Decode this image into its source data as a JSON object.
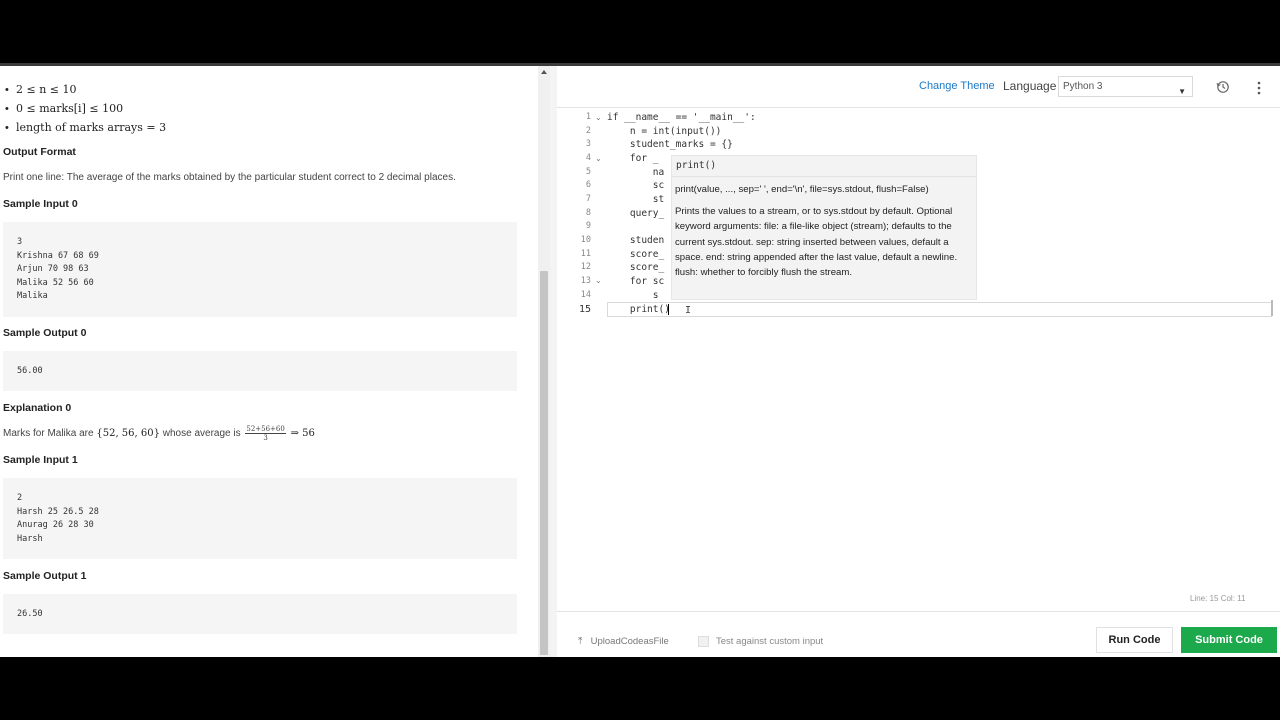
{
  "problem": {
    "constraints": [
      "2 ≤ n ≤ 10",
      "0 ≤ marks[i] ≤ 100",
      "length of marks arrays = 3"
    ],
    "output_format_title": "Output Format",
    "output_format_text": "Print one line: The average of the marks obtained by the particular student correct to 2 decimal places.",
    "sample_input_0_title": "Sample Input 0",
    "sample_input_0_lines": [
      "3",
      "Krishna 67 68 69",
      "Arjun 70 98 63",
      "Malika 52 56 60",
      "Malika"
    ],
    "sample_output_0_title": "Sample Output 0",
    "sample_output_0_value": "56.00",
    "explanation_0_title": "Explanation 0",
    "explanation_0_prefix": "Marks for Malika are",
    "explanation_0_set": "{52, 56, 60}",
    "explanation_0_middle": "whose average is",
    "explanation_0_numerator": "52+56+60",
    "explanation_0_denominator": "3",
    "explanation_0_result": "⇒ 56",
    "sample_input_1_title": "Sample Input 1",
    "sample_input_1_lines": [
      "2",
      "Harsh 25 26.5 28",
      "Anurag 26 28 30",
      "Harsh"
    ],
    "sample_output_1_title": "Sample Output 1",
    "sample_output_1_value": "26.50"
  },
  "editor": {
    "change_theme": "Change Theme",
    "language_label": "Language",
    "language_value": "Python 3",
    "line_numbers": [
      "1",
      "2",
      "3",
      "4",
      "5",
      "6",
      "7",
      "8",
      "9",
      "10",
      "11",
      "12",
      "13",
      "14",
      "15"
    ],
    "code_lines": [
      "if __name__ == '__main__':",
      "    n = int(input())",
      "    student_marks = {}",
      "    for _",
      "        na",
      "        sc",
      "        st",
      "    query_",
      "",
      "    studen",
      "    score_",
      "    score_",
      "    for sc",
      "        s",
      "    print()"
    ],
    "status": "Line: 15  Col: 11"
  },
  "tooltip": {
    "signature": "print()",
    "full_signature": "print(value, ..., sep=' ', end='\\n', file=sys.stdout, flush=False)",
    "doc": "Prints the values to a stream, or to sys.stdout by default. Optional keyword arguments: file: a file-like object (stream); defaults to the current sys.stdout. sep: string inserted between values, default a space. end: string appended after the last value, default a newline. flush: whether to forcibly flush the stream."
  },
  "footer": {
    "upload_label": "UploadCodeasFile",
    "custom_input_label": "Test against custom input",
    "run_label": "Run Code",
    "submit_label": "Submit Code"
  },
  "icons": {
    "upload": "upload-arrow-icon",
    "history": "history-icon",
    "more": "kebab-menu-icon",
    "select_caret": "chevron-down-icon"
  },
  "colors": {
    "submit_green": "#1ba94c",
    "link_blue": "#1a79c9"
  }
}
